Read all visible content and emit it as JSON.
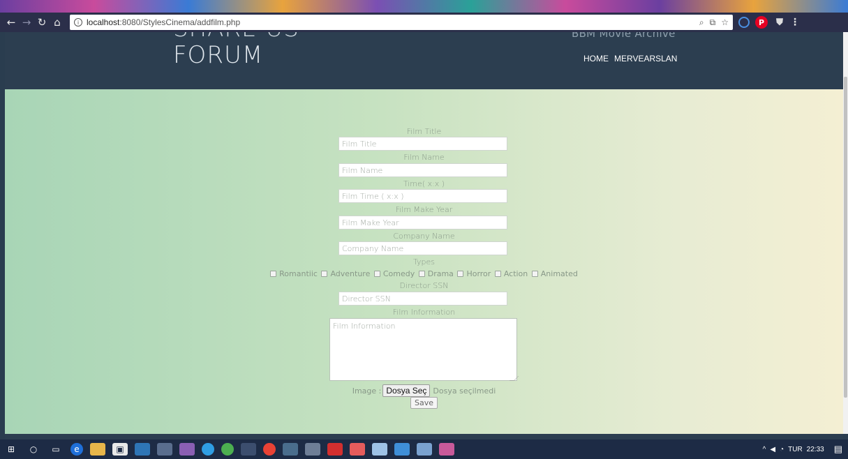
{
  "browser": {
    "url_host": "localhost",
    "url_path": ":8080/StylesCinema/addfilm.php",
    "back_icon": "arrow-left-icon",
    "forward_icon": "arrow-right-icon",
    "reload_icon": "reload-icon",
    "home_icon": "home-icon"
  },
  "site": {
    "logo_line1": "SHARE US",
    "logo_line2": "FORUM",
    "subtitle": "BBM Movie Archive",
    "nav": [
      "HOME",
      "MERVEARSLAN"
    ]
  },
  "form": {
    "film_title_label": "Film Title",
    "film_title_placeholder": "Film Title",
    "film_name_label": "Film Name",
    "film_name_placeholder": "Film Name",
    "time_label": "Time( x:x )",
    "time_placeholder": "Film Time ( x:x )",
    "make_year_label": "Film Make Year",
    "make_year_placeholder": "Film Make Year",
    "company_label": "Company Name",
    "company_placeholder": "Company Name",
    "types_label": "Types",
    "types": [
      "Romantiic",
      "Adventure",
      "Comedy",
      "Drama",
      "Horror",
      "Action",
      "Animated"
    ],
    "director_label": "Director SSN",
    "director_placeholder": "Director SSN",
    "info_label": "Film Information",
    "info_placeholder": "Film Information",
    "image_label": "Image :",
    "file_button": "Dosya Seç",
    "file_status": "Dosya seçilmedi",
    "save_button": "Save"
  },
  "taskbar": {
    "language": "TUR",
    "time": "22:33"
  }
}
